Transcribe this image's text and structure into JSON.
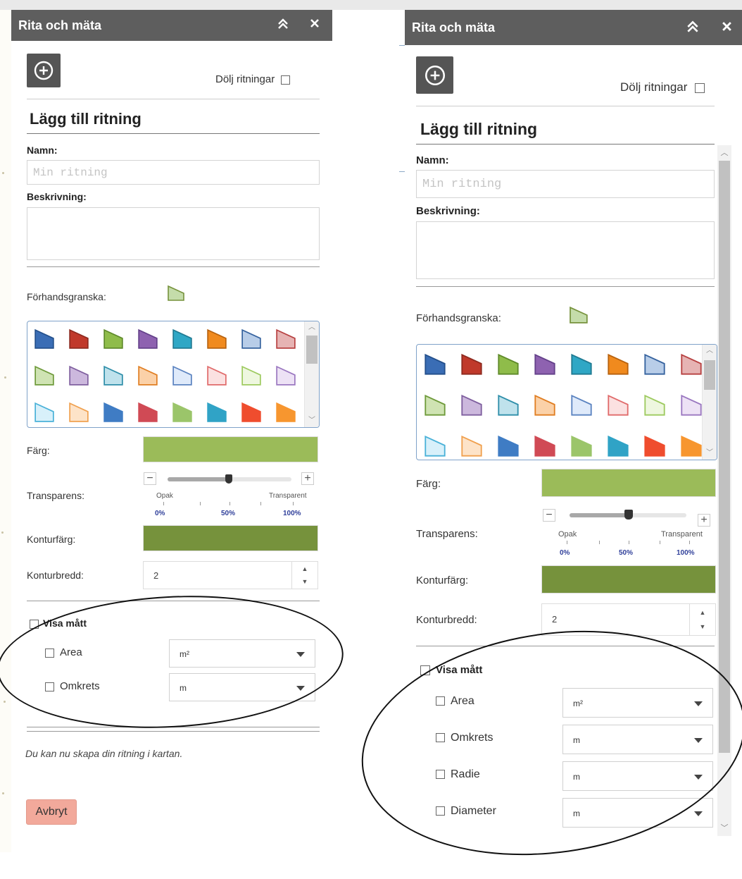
{
  "panel_title": "Rita och mäta",
  "collapse_icon": "double-chevron-up-icon",
  "close_icon": "close-icon",
  "add_icon": "circle-plus-icon",
  "hide_drawings_label": "Dölj ritningar",
  "section_heading": "Lägg till ritning",
  "name_label": "Namn:",
  "name_placeholder": "Min ritning",
  "description_label": "Beskrivning:",
  "preview_label": "Förhandsgranska:",
  "color_label": "Färg:",
  "transparency_label": "Transparens:",
  "outline_color_label": "Konturfärg:",
  "outline_width_label": "Konturbredd:",
  "outline_width_value": "2",
  "slider": {
    "minus": "−",
    "plus": "+",
    "min_label": "Opak",
    "max_label": "Transparent",
    "pct_0": "0%",
    "pct_50": "50%",
    "pct_100": "100%",
    "value": 0.5
  },
  "show_measure_label": "Visa mått",
  "left_measures": [
    {
      "label": "Area",
      "unit": "m²"
    },
    {
      "label": "Omkrets",
      "unit": "m"
    }
  ],
  "right_measures": [
    {
      "label": "Area",
      "unit": "m²"
    },
    {
      "label": "Omkrets",
      "unit": "m"
    },
    {
      "label": "Radie",
      "unit": "m"
    },
    {
      "label": "Diameter",
      "unit": "m"
    }
  ],
  "hint_text": "Du kan nu skapa din ritning i kartan.",
  "cancel_label": "Avbryt",
  "colors": {
    "fill": "#9bbb59",
    "outline": "#76923c",
    "preview_fill": "#c4dcaa",
    "preview_stroke": "#76923c",
    "cancel": "#f2a99b",
    "titlebar": "#5e5e5e"
  },
  "symbols": [
    {
      "fill": "#3a6db5",
      "stroke": "#24508c"
    },
    {
      "fill": "#c0392b",
      "stroke": "#8e2a1f"
    },
    {
      "fill": "#8fbc4a",
      "stroke": "#5f8a2a"
    },
    {
      "fill": "#8e62b0",
      "stroke": "#64418a"
    },
    {
      "fill": "#2fa7c5",
      "stroke": "#1f7a92"
    },
    {
      "fill": "#f08a1e",
      "stroke": "#b8620e"
    },
    {
      "fill": "#b8cde8",
      "stroke": "#35629e"
    },
    {
      "fill": "#e6b3b3",
      "stroke": "#b74040"
    },
    {
      "fill": "#cfe3b3",
      "stroke": "#6e9a3a"
    },
    {
      "fill": "#ccb8dd",
      "stroke": "#7f5f9f"
    },
    {
      "fill": "#bfe2ec",
      "stroke": "#2e8ea9"
    },
    {
      "fill": "#fbd1a8",
      "stroke": "#e07e22"
    },
    {
      "fill": "#dfeafa",
      "stroke": "#5b83c0"
    },
    {
      "fill": "#fbe1e1",
      "stroke": "#e06a6a"
    },
    {
      "fill": "#eef7df",
      "stroke": "#9dca5f"
    },
    {
      "fill": "#ede2f5",
      "stroke": "#9a77c0"
    },
    {
      "fill": "#d8f0fa",
      "stroke": "#49b1d8"
    },
    {
      "fill": "#fde3c8",
      "stroke": "#f0a04e"
    },
    {
      "fill": "#3f7cc4",
      "stroke": "#3f7cc4"
    },
    {
      "fill": "#d04a55",
      "stroke": "#d04a55"
    },
    {
      "fill": "#9bc56a",
      "stroke": "#9bc56a"
    },
    {
      "fill": "#30a3c6",
      "stroke": "#30a3c6"
    },
    {
      "fill": "#ef4d2e",
      "stroke": "#ef4d2e"
    },
    {
      "fill": "#f7962f",
      "stroke": "#f7962f"
    }
  ]
}
